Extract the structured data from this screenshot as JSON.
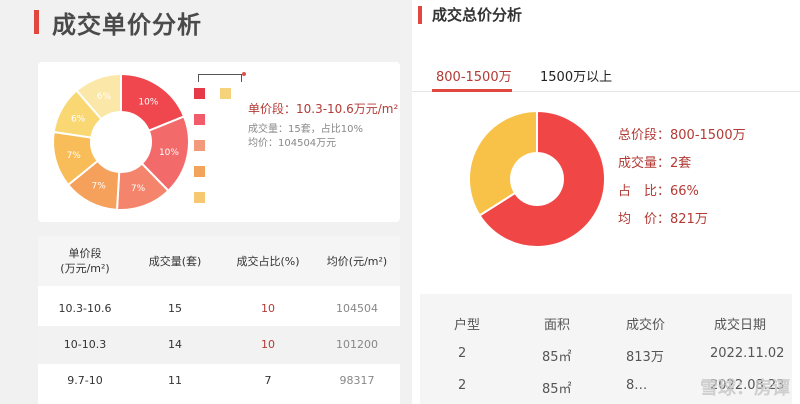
{
  "left": {
    "title": "成交单价分析",
    "donut": {
      "slices": [
        {
          "value": 10,
          "label": "10%",
          "color": "#f0474e"
        },
        {
          "value": 10,
          "label": "10%",
          "color": "#f36a6a"
        },
        {
          "value": 7,
          "label": "7%",
          "color": "#f4856c"
        },
        {
          "value": 7,
          "label": "7%",
          "color": "#f5a05b"
        },
        {
          "value": 7,
          "label": "7%",
          "color": "#f8bd58"
        },
        {
          "value": 6,
          "label": "6%",
          "color": "#f9d874"
        },
        {
          "value": 6,
          "label": "6%",
          "color": "#fbe7a8"
        }
      ]
    },
    "legend_colors": [
      "#e73a48",
      "#f5d37a",
      "#f25c6a",
      "#f39a7c",
      "#f3a45c",
      "#f7c872"
    ],
    "info": {
      "range": "单价段：10.3-10.6万元/m²",
      "count": "成交量：15套，占比10%",
      "avg": "均价：104504万元"
    },
    "table": {
      "headers": [
        "单价段\n(万元/m²)",
        "成交量(套)",
        "成交占比(%)",
        "均价(元/m²)"
      ],
      "rows": [
        [
          "10.3-10.6",
          "15",
          "10",
          "104504"
        ],
        [
          "10-10.3",
          "14",
          "10",
          "101200"
        ],
        [
          "9.7-10",
          "11",
          "7",
          "98317"
        ]
      ]
    }
  },
  "right": {
    "title": "成交总价分析",
    "tabs": [
      {
        "label": "800-1500万",
        "active": true
      },
      {
        "label": "1500万以上",
        "active": false
      }
    ],
    "pie": {
      "slices": [
        {
          "value": 66,
          "color": "#f04646"
        },
        {
          "value": 34,
          "color": "#f8c248"
        }
      ]
    },
    "stats": [
      "总价段：800-1500万",
      "成交量：2套",
      "占　比：66%",
      "均　价：821万"
    ],
    "table": {
      "headers": [
        "户型",
        "面积",
        "成交价",
        "成交日期"
      ],
      "rows": [
        [
          "2",
          "85㎡",
          "813万",
          "2022.11.02"
        ],
        [
          "2",
          "85㎡",
          "8…",
          "2022.08.23"
        ]
      ]
    }
  },
  "watermark": "雪球：房谭"
}
